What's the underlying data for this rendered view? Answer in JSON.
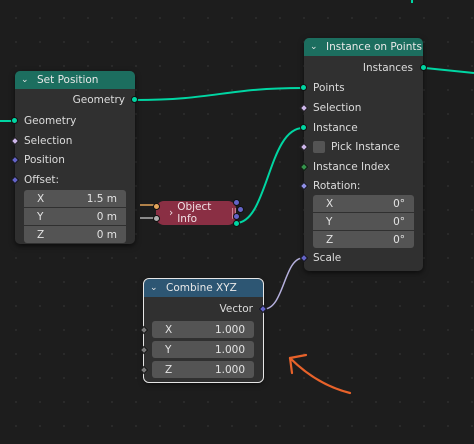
{
  "colors": {
    "geometry_header": "#1c6e5f",
    "vector_header": "#2d5673",
    "object_info_body": "#8a2f44",
    "geometry_socket": "#00d6a3",
    "vector_socket": "#6363c7",
    "annotation_arrow": "#e8622a"
  },
  "set_position": {
    "title": "Set Position",
    "out_geometry": "Geometry",
    "in_geometry": "Geometry",
    "in_selection": "Selection",
    "in_position": "Position",
    "in_offset": "Offset:",
    "offset": [
      {
        "axis": "X",
        "value": "1.5 m"
      },
      {
        "axis": "Y",
        "value": "0 m"
      },
      {
        "axis": "Z",
        "value": "0 m"
      }
    ]
  },
  "instance_on_points": {
    "title": "Instance on Points",
    "out_instances": "Instances",
    "in_points": "Points",
    "in_selection": "Selection",
    "in_instance": "Instance",
    "pick_instance": "Pick Instance",
    "in_instance_index": "Instance Index",
    "in_rotation": "Rotation:",
    "rotation": [
      {
        "axis": "X",
        "value": "0°"
      },
      {
        "axis": "Y",
        "value": "0°"
      },
      {
        "axis": "Z",
        "value": "0°"
      }
    ],
    "in_scale": "Scale"
  },
  "object_info": {
    "title": "Object Info",
    "hidden_icon": "hidden-sockets-icon"
  },
  "combine_xyz": {
    "title": "Combine XYZ",
    "out_vector": "Vector",
    "inputs": [
      {
        "axis": "X",
        "value": "1.000"
      },
      {
        "axis": "Y",
        "value": "1.000"
      },
      {
        "axis": "Z",
        "value": "1.000"
      }
    ]
  },
  "icons": {
    "collapse": "chevron-down-icon",
    "expand": "chevron-right-icon"
  }
}
